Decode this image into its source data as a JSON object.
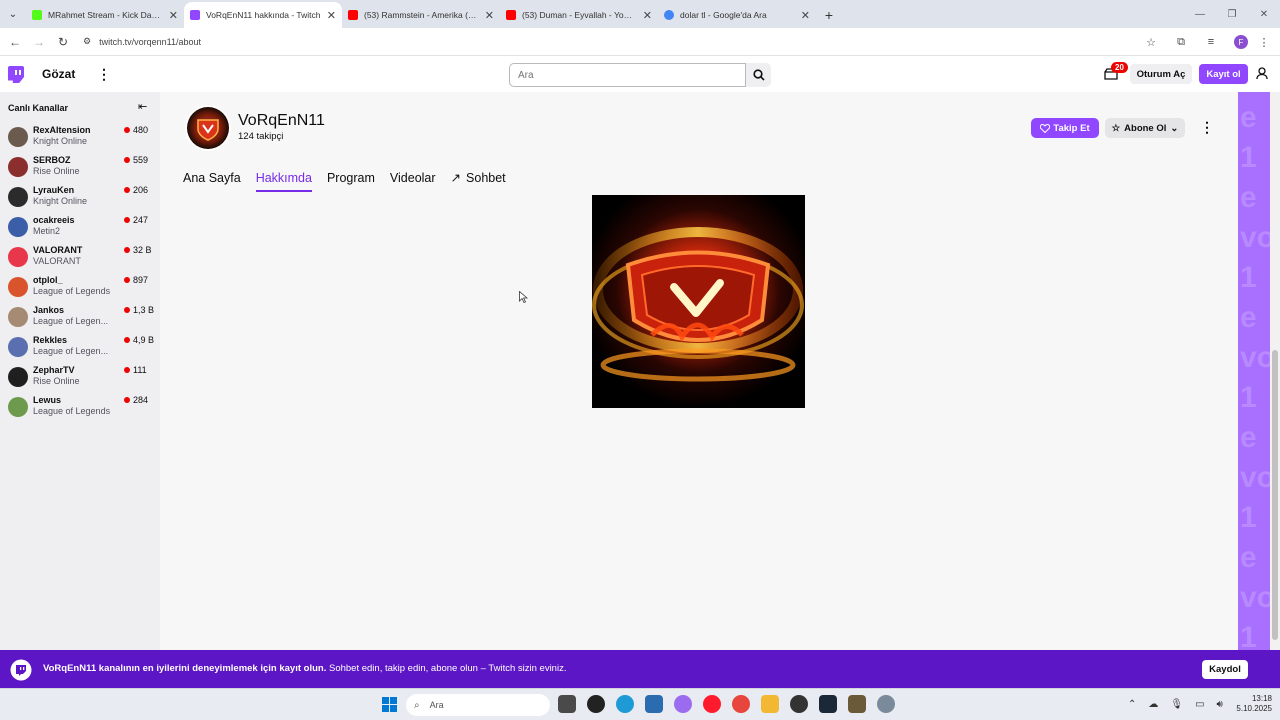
{
  "browser": {
    "tabs": [
      {
        "title": "MRahmet Stream - Kick Dashb",
        "favicon_color": "#53fc18",
        "active": false
      },
      {
        "title": "VoRqEnN11 hakkında - Twitch",
        "favicon_color": "#9147ff",
        "active": true
      },
      {
        "title": "(53) Rammstein - Amerika (Offi",
        "favicon_color": "#ff0000",
        "active": false
      },
      {
        "title": "(53) Duman - Eyvallah - YouTu",
        "favicon_color": "#ff0000",
        "active": false
      },
      {
        "title": "dolar tl - Google'da Ara",
        "favicon_color": "#4285f4",
        "active": false
      }
    ],
    "url": "twitch.tv/vorqenn11/about",
    "profile_initial": "F"
  },
  "topnav": {
    "browse_label": "Gözat",
    "search_placeholder": "Ara",
    "notification_count": "20",
    "login_label": "Oturum Aç",
    "signup_label": "Kayıt ol"
  },
  "sidebar": {
    "heading": "Canlı Kanallar",
    "channels": [
      {
        "name": "RexAltension",
        "game": "Knight Online",
        "viewers": "480",
        "avatar_color": "#6b5a4e"
      },
      {
        "name": "SERBOZ",
        "game": "Rise Online",
        "viewers": "559",
        "avatar_color": "#8b2e2e"
      },
      {
        "name": "LyrauKen",
        "game": "Knight Online",
        "viewers": "206",
        "avatar_color": "#2b2b2b"
      },
      {
        "name": "ocakreeis",
        "game": "Metin2",
        "viewers": "247",
        "avatar_color": "#3a5ea8"
      },
      {
        "name": "VALORANT",
        "game": "VALORANT",
        "viewers": "32 B",
        "avatar_color": "#e8364a"
      },
      {
        "name": "otplol_",
        "game": "League of Legends",
        "viewers": "897",
        "avatar_color": "#d9532c"
      },
      {
        "name": "Jankos",
        "game": "League of Legen...",
        "viewers": "1,3 B",
        "avatar_color": "#a58a74"
      },
      {
        "name": "Rekkles",
        "game": "League of Legen...",
        "viewers": "4,9 B",
        "avatar_color": "#5a6fb0"
      },
      {
        "name": "ZepharTV",
        "game": "Rise Online",
        "viewers": "111",
        "avatar_color": "#1f1f1f"
      },
      {
        "name": "Lewus",
        "game": "League of Legends",
        "viewers": "284",
        "avatar_color": "#6e9a4e"
      }
    ]
  },
  "channel": {
    "name": "VoRqEnN11",
    "followers": "124 takipçi",
    "follow_label": "Takip Et",
    "subscribe_label": "Abone Ol",
    "tabs": [
      {
        "label": "Ana Sayfa",
        "active": false
      },
      {
        "label": "Hakkımda",
        "active": true
      },
      {
        "label": "Program",
        "active": false
      },
      {
        "label": "Videolar",
        "active": false
      },
      {
        "label": "Sohbet",
        "active": false
      }
    ]
  },
  "banner": {
    "bold_text": "VoRqEnN11 kanalının en iyilerini deneyimlemek için kayıt olun.",
    "text": "Sohbet edin, takip edin, abone olun – Twitch sizin eviniz.",
    "save_label": "Kaydol"
  },
  "taskbar": {
    "search_placeholder": "Ara",
    "time": "13:18",
    "date": "5.10.2025"
  },
  "colors": {
    "twitch_purple": "#9147ff",
    "banner_purple": "#5c16c5",
    "live_red": "#eb0400"
  }
}
